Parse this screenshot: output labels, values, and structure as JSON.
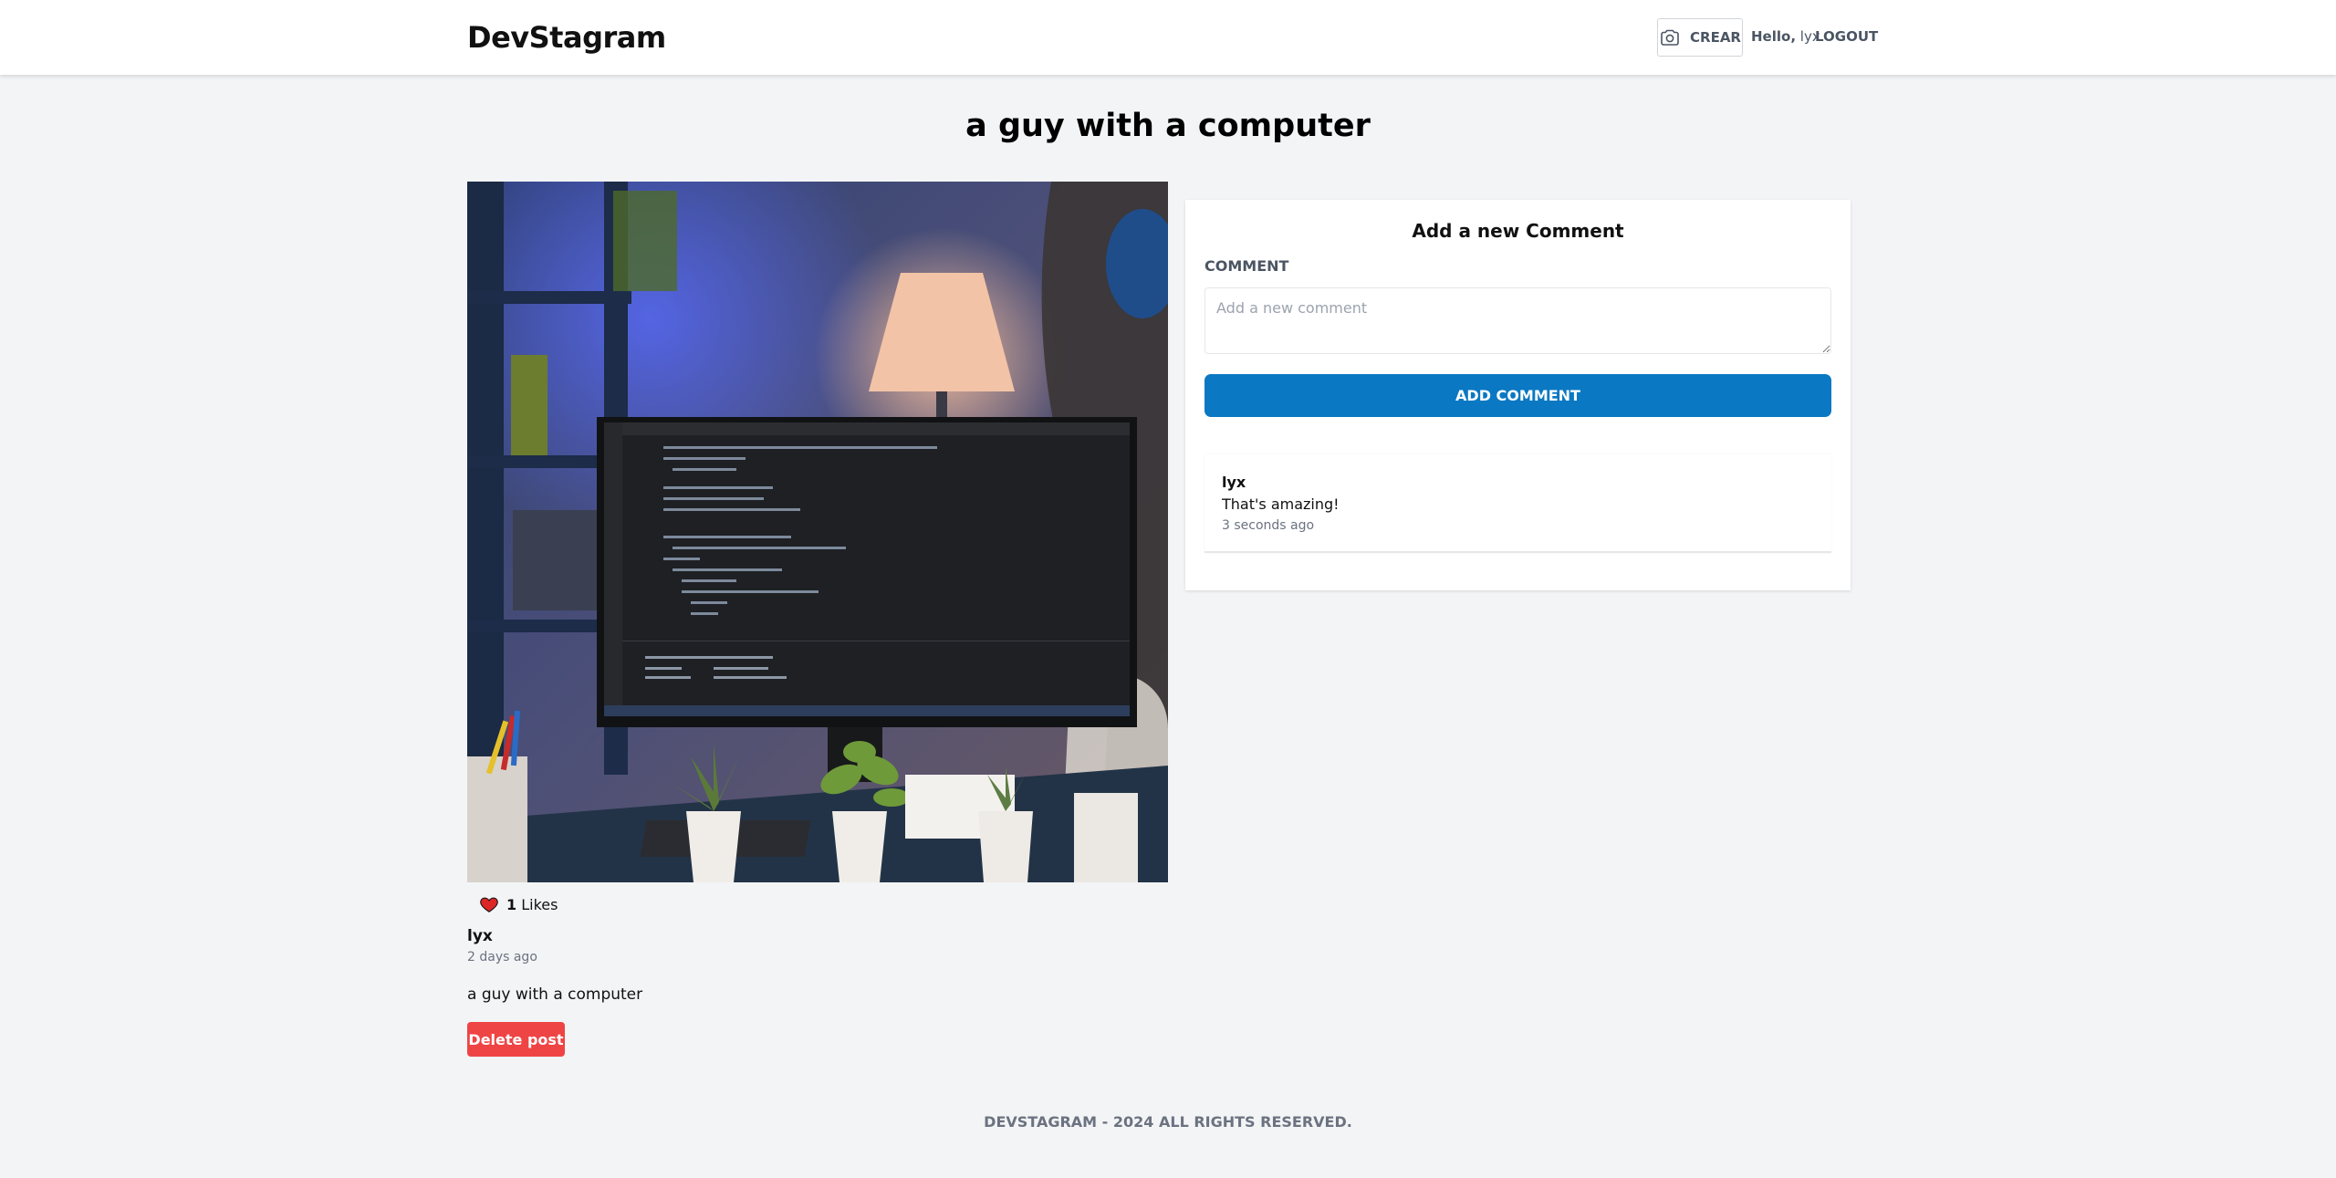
{
  "header": {
    "brand": "DevStagram",
    "create_label": "CREAR",
    "greeting_prefix": "Hello,",
    "username": "lyx",
    "logout_label": "LOGOUT",
    "create_icon": "camera-icon"
  },
  "post": {
    "title": "a guy with a computer",
    "likes_count": "1",
    "likes_label": "Likes",
    "like_icon": "heart-icon",
    "author": "lyx",
    "time": "2 days ago",
    "description": "a guy with a computer",
    "delete_label": "Delete post"
  },
  "comments": {
    "heading": "Add a new Comment",
    "field_label": "COMMENT",
    "placeholder": "Add a new comment",
    "value": "",
    "submit_label": "ADD COMMENT",
    "items": [
      {
        "author": "lyx",
        "text": "That's amazing!",
        "time": "3 seconds ago"
      }
    ]
  },
  "footer": {
    "text": "DEVSTAGRAM - 2024 ALL RIGHTS RESERVED."
  },
  "colors": {
    "accent": "#0a78c2",
    "danger": "#ef4444",
    "like": "#dc2626",
    "background": "#f3f4f6"
  }
}
